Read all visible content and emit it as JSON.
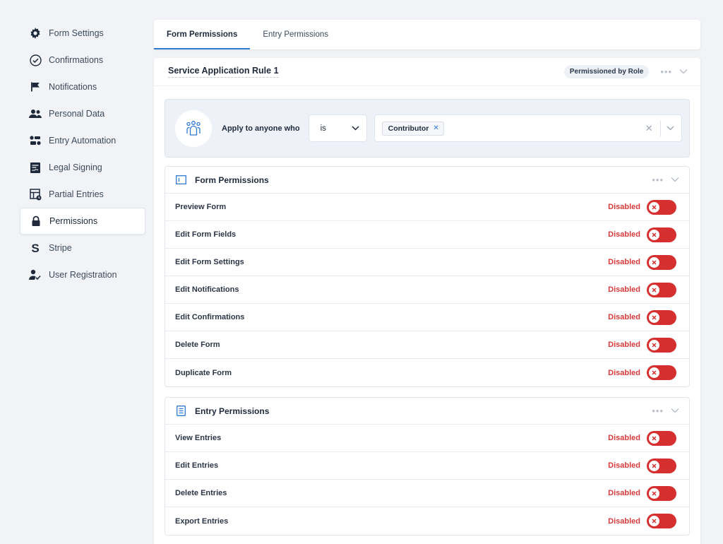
{
  "sidebar": {
    "items": [
      {
        "label": "Form Settings",
        "icon": "gear-icon"
      },
      {
        "label": "Confirmations",
        "icon": "check-circle-icon"
      },
      {
        "label": "Notifications",
        "icon": "flag-icon"
      },
      {
        "label": "Personal Data",
        "icon": "users-icon"
      },
      {
        "label": "Entry Automation",
        "icon": "automation-icon"
      },
      {
        "label": "Legal Signing",
        "icon": "signature-doc-icon"
      },
      {
        "label": "Partial Entries",
        "icon": "table-icon"
      },
      {
        "label": "Permissions",
        "icon": "lock-icon",
        "active": true
      },
      {
        "label": "Stripe",
        "icon": "stripe-icon"
      },
      {
        "label": "User Registration",
        "icon": "user-check-icon"
      }
    ]
  },
  "tabs": [
    {
      "label": "Form Permissions",
      "active": true
    },
    {
      "label": "Entry Permissions",
      "active": false
    }
  ],
  "rule": {
    "title": "Service Application Rule 1",
    "badge": "Permissioned by Role",
    "dots": "•••"
  },
  "condition": {
    "label": "Apply to anyone who",
    "operator": "is",
    "tag": "Contributor"
  },
  "form_permissions": {
    "title": "Form Permissions",
    "items": [
      {
        "name": "Preview Form",
        "status": "Disabled"
      },
      {
        "name": "Edit Form Fields",
        "status": "Disabled"
      },
      {
        "name": "Edit Form Settings",
        "status": "Disabled"
      },
      {
        "name": "Edit Notifications",
        "status": "Disabled"
      },
      {
        "name": "Edit Confirmations",
        "status": "Disabled"
      },
      {
        "name": "Delete Form",
        "status": "Disabled"
      },
      {
        "name": "Duplicate Form",
        "status": "Disabled"
      }
    ]
  },
  "entry_permissions": {
    "title": "Entry Permissions",
    "items": [
      {
        "name": "View Entries",
        "status": "Disabled"
      },
      {
        "name": "Edit Entries",
        "status": "Disabled"
      },
      {
        "name": "Delete Entries",
        "status": "Disabled"
      },
      {
        "name": "Export Entries",
        "status": "Disabled"
      }
    ]
  },
  "colors": {
    "accent": "#2f7ad1",
    "disabled_red": "#d62f2f",
    "background": "#f1f3f7"
  }
}
